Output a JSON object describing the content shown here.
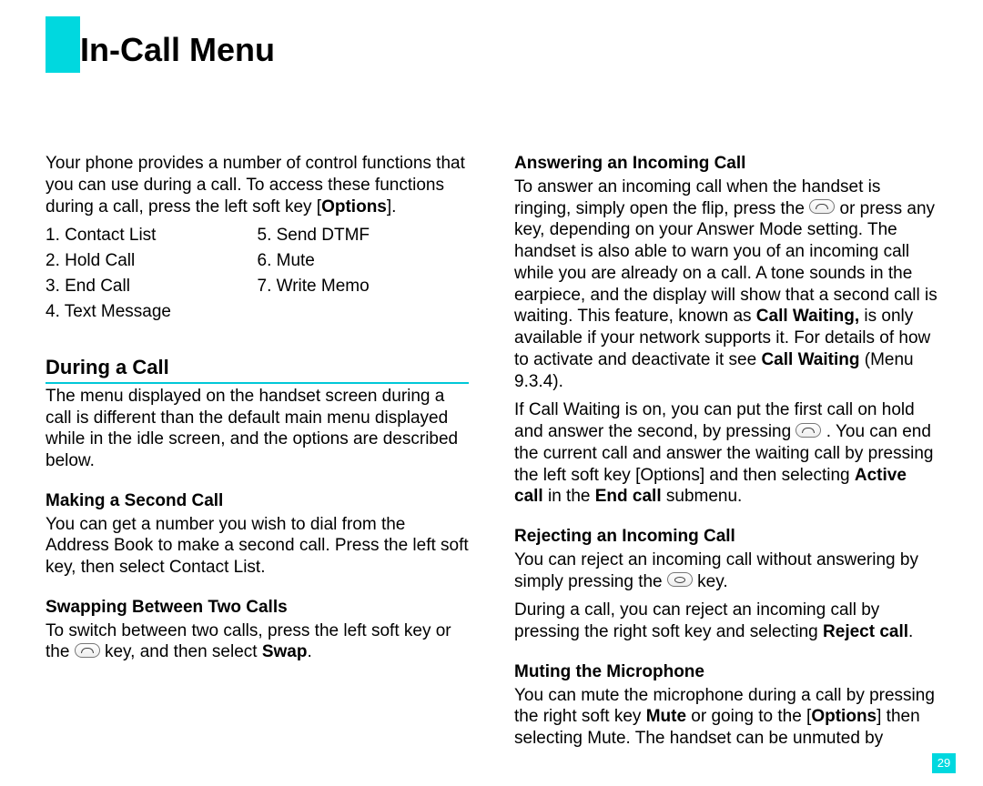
{
  "title": "In-Call Menu",
  "intro_pre": "Your phone provides a number of control functions that you can use during a call. To access these functions during a call, press the left soft key [",
  "intro_bold": "Options",
  "intro_post": "].",
  "options_left": [
    "1. Contact List",
    "2. Hold Call",
    "3. End Call",
    "4. Text Message"
  ],
  "options_right": [
    "5. Send DTMF",
    "6. Mute",
    "7. Write Memo"
  ],
  "during_heading": "During a Call",
  "during_text": "The menu displayed on the handset screen during a call is different than the default main menu displayed while in the idle screen, and the options are described below.",
  "making_heading": "Making a Second Call",
  "making_text": "You can get a number you wish to dial from the Address Book to make a second call. Press the left soft key, then select Contact List.",
  "swap_heading": "Swapping Between Two Calls",
  "swap_pre": "To switch between two calls, press the left soft key or the ",
  "swap_mid": " key, and then select ",
  "swap_bold": "Swap",
  "swap_post": ".",
  "answer_heading": "Answering an Incoming Call",
  "answer_p1_pre": "To answer an incoming call when the handset is ringing, simply open the flip, press the ",
  "answer_p1_mid": " or press any key, depending on your Answer Mode setting. The handset is also able to warn you of an incoming call while you are already on a call. A tone sounds in the earpiece, and the display will show that a second call is waiting. This feature, known as ",
  "answer_cw_bold": "Call Waiting,",
  "answer_p1_mid2": " is only available if your network supports it. For details of how to activate and deactivate it see ",
  "answer_cw_bold2": "Call Waiting",
  "answer_p1_post": " (Menu 9.3.4).",
  "answer_p2_pre": "If Call Waiting is on, you can put the first call on hold and answer the second, by pressing ",
  "answer_p2_mid": " . You can end the current call and answer the waiting call by pressing the left soft key [Options] and then selecting ",
  "answer_active_bold": "Active call",
  "answer_in": " in the ",
  "answer_endcall_bold": "End call",
  "answer_submenu": " submenu.",
  "reject_heading": "Rejecting an Incoming Call",
  "reject_p1_pre": "You can reject an incoming call without answering by simply pressing the ",
  "reject_p1_post": " key.",
  "reject_p2_pre": "During a call, you can reject an incoming call by pressing the right soft key and selecting ",
  "reject_bold": "Reject call",
  "reject_p2_post": ".",
  "mute_heading": "Muting the Microphone",
  "mute_pre": "You can mute the microphone during a call by pressing the right soft key ",
  "mute_bold1": "Mute",
  "mute_mid": " or going to the [",
  "mute_bold2": "Options",
  "mute_post": "] then selecting Mute. The handset can be unmuted by",
  "page_number": "29"
}
